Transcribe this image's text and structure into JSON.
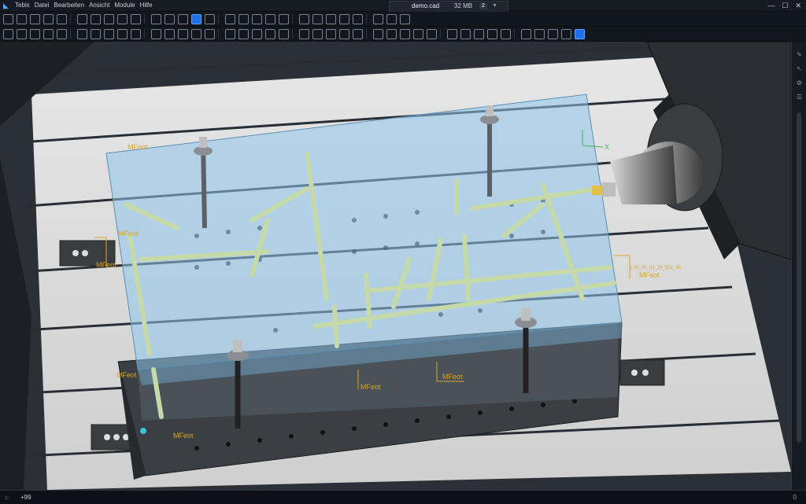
{
  "app": {
    "menu": [
      "Tebis",
      "Datei",
      "Bearbeiten",
      "Ansicht",
      "Module",
      "Hilfe"
    ]
  },
  "document": {
    "name": "demo.cad",
    "memory": "32 MB",
    "badge": "2"
  },
  "toolbar_top": {
    "icons": [
      "open-icon",
      "new-folder-icon",
      "save-icon",
      "print-icon",
      "cut-icon",
      "rotate-icon",
      "transform-icon",
      "lights-icon",
      "view-icon",
      "hide-icon",
      "analyze-icon",
      "cube-wireframe-icon",
      "cube-shaded-icon",
      "cube-active-icon",
      "layers-icon",
      "copy-icon",
      "zoom-icon",
      "fit-icon",
      "filter-icon",
      "rotate-view-icon",
      "grid-icon",
      "snap-icon",
      "plane-icon",
      "box-icon",
      "wrench-icon",
      "measure-icon",
      "pin-icon",
      "bar-icon"
    ],
    "active_index": 13
  },
  "toolbar_bottom": {
    "icons": [
      "solid-1-icon",
      "solid-2-icon",
      "solid-3-icon",
      "solid-4-icon",
      "solid-5-icon",
      "solid-6-icon",
      "solid-7-icon",
      "solid-8-icon",
      "solid-9-icon",
      "axis-1-icon",
      "axis-2-icon",
      "axis-3-icon",
      "axis-4-icon",
      "axis-5-icon",
      "face-1-icon",
      "face-2-icon",
      "face-3-icon",
      "face-4-icon",
      "face-5-icon",
      "face-6-icon",
      "face-7-icon",
      "face-8-icon",
      "face-9-icon",
      "face-10-icon",
      "text-abc-1-icon",
      "text-abc-2-icon",
      "text-abc-3-icon",
      "cube-select-icon",
      "point-icon",
      "axis-check-icon",
      "curve-1-icon",
      "curve-2-icon",
      "curve-3-icon",
      "curve-4-icon",
      "curve-5-icon",
      "curve-6-icon",
      "curve-7-icon",
      "curve-8-icon",
      "curve-9-icon",
      "surface-active-icon"
    ],
    "active_index": 39
  },
  "viewport": {
    "labels": {
      "mfeot_a": "MFeot",
      "mfeot_b": "MFeot",
      "mfeot_c": "MFeot",
      "mfeot_d": "MFeot",
      "mfeot_e": "MFeot",
      "mfeot_f": "MFeot",
      "mfeot_g": "MFeot",
      "mfeot_h": "MFeot",
      "mfeot_i": "MFeot",
      "axis_x": "X",
      "dim_note": "1.00_05_01_10_502_30"
    }
  },
  "status": {
    "zoom": "+99",
    "count": "0"
  },
  "colors": {
    "ui_bg": "#161b22",
    "accent": "#1f6feb",
    "block_blue": "#8fc7ec",
    "annotation": "#d6a62a",
    "pipe": "#c6d9a8"
  }
}
